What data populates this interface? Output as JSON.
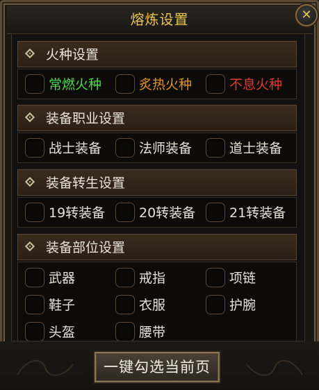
{
  "window": {
    "title": "熔炼设置",
    "close_icon": "close-icon"
  },
  "sections": [
    {
      "title": "火种设置",
      "options": [
        {
          "label": "常燃火种",
          "color": "#4fd84a",
          "checked": false
        },
        {
          "label": "炙热火种",
          "color": "#e0922a",
          "checked": false
        },
        {
          "label": "不息火种",
          "color": "#e03a2a",
          "checked": false
        }
      ]
    },
    {
      "title": "装备职业设置",
      "options": [
        {
          "label": "战士装备",
          "checked": false
        },
        {
          "label": "法师装备",
          "checked": false
        },
        {
          "label": "道士装备",
          "checked": false
        }
      ]
    },
    {
      "title": "装备转生设置",
      "options": [
        {
          "label": "19转装备",
          "checked": false
        },
        {
          "label": "20转装备",
          "checked": false
        },
        {
          "label": "21转装备",
          "checked": false
        }
      ]
    },
    {
      "title": "装备部位设置",
      "options": [
        {
          "label": "武器",
          "checked": false
        },
        {
          "label": "戒指",
          "checked": false
        },
        {
          "label": "项链",
          "checked": false
        },
        {
          "label": "鞋子",
          "checked": false
        },
        {
          "label": "衣服",
          "checked": false
        },
        {
          "label": "护腕",
          "checked": false
        },
        {
          "label": "头盔",
          "checked": false
        },
        {
          "label": "腰带",
          "checked": false
        }
      ]
    }
  ],
  "footer": {
    "select_page_button": "一键勾选当前页"
  }
}
